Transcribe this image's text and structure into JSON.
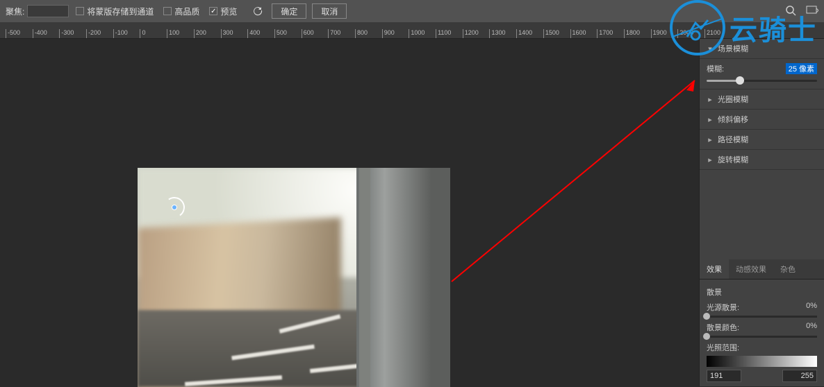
{
  "toolbar": {
    "focus_label": "聚焦:",
    "save_mask_to_channel": "将蒙版存储到通道",
    "high_quality": "高品质",
    "preview": "预览",
    "ok": "确定",
    "cancel": "取消"
  },
  "ruler": {
    "ticks": [
      "-500",
      "-400",
      "-300",
      "-200",
      "-100",
      "0",
      "100",
      "200",
      "300",
      "400",
      "500",
      "600",
      "700",
      "800",
      "900",
      "1000",
      "1100",
      "1200",
      "1300",
      "1400",
      "1500",
      "1600",
      "1700",
      "1800",
      "1900",
      "2000",
      "2100"
    ]
  },
  "panel": {
    "field_blur": "场景模糊",
    "blur_label": "模糊:",
    "blur_value": "25 像素",
    "blur_percent": 30,
    "iris_blur": "光圈模糊",
    "tilt_shift": "倾斜偏移",
    "path_blur": "路径模糊",
    "spin_blur": "旋转模糊"
  },
  "effects": {
    "tab_effects": "效果",
    "tab_motion": "动感效果",
    "tab_noise": "杂色",
    "bokeh_title": "散景",
    "light_bokeh": "光源散景:",
    "light_bokeh_val": "0%",
    "bokeh_color": "散景颜色:",
    "bokeh_color_val": "0%",
    "light_range": "光照范围:",
    "range_low": "191",
    "range_high": "255"
  },
  "watermark": {
    "text": "云骑士"
  },
  "chart_data": {
    "type": "slider",
    "title": "模糊 (Blur)",
    "value": 25,
    "unit": "像素",
    "range_approx": [
      0,
      100
    ]
  }
}
